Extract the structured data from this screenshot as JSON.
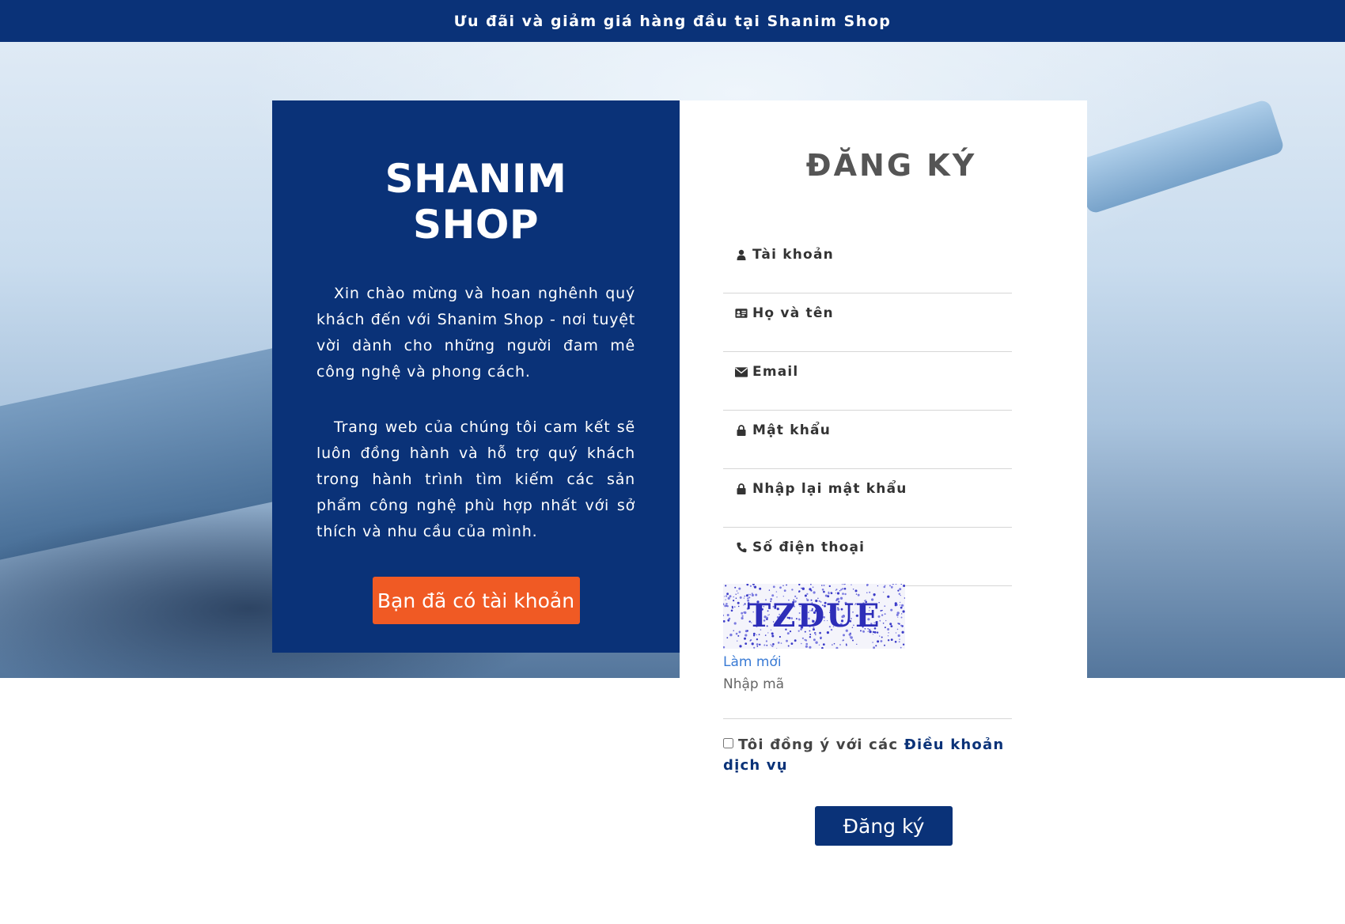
{
  "topbar": {
    "text": "Ưu đãi và giảm giá hàng đầu tại Shanim Shop"
  },
  "left_panel": {
    "brand": "SHANIM SHOP",
    "intro_1": "Xin chào mừng và hoan nghênh quý khách đến với Shanim Shop - nơi tuyệt vời dành cho những người đam mê công nghệ và phong cách.",
    "intro_2": "Trang web của chúng tôi cam kết sẽ luôn đồng hành và hỗ trợ quý khách trong hành trình tìm kiếm các sản phẩm công nghệ phù hợp nhất với sở thích và nhu cầu của mình.",
    "login_button": "Bạn đã có tài khoản"
  },
  "form": {
    "title": "ĐĂNG KÝ",
    "fields": [
      {
        "label": "Tài khoản",
        "icon": "user-icon",
        "value": ""
      },
      {
        "label": "Họ và tên",
        "icon": "id-card-icon",
        "value": ""
      },
      {
        "label": "Email",
        "icon": "envelope-icon",
        "value": ""
      },
      {
        "label": "Mật khẩu",
        "icon": "lock-icon",
        "value": ""
      },
      {
        "label": "Nhập lại mật khẩu",
        "icon": "lock-icon",
        "value": ""
      },
      {
        "label": "Số điện thoại",
        "icon": "phone-icon",
        "value": ""
      }
    ],
    "captcha_text": "TZDUE",
    "refresh_label": "Làm mới",
    "captcha_placeholder": "Nhập mã",
    "terms_prefix": "Tôi đồng ý với các",
    "terms_link": "Điều khoản dịch vụ",
    "submit_label": "Đăng ký"
  },
  "colors": {
    "primary": "#0a3278",
    "accent": "#f05a24",
    "link": "#3a7bd5"
  }
}
